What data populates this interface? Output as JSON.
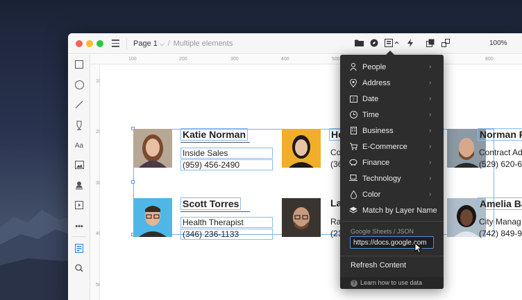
{
  "header": {
    "page_label": "Page 1",
    "breadcrumb_sub": "Multiple elements",
    "zoom": "100%"
  },
  "rulers": {
    "top": [
      "100",
      "200",
      "300",
      "400",
      "500",
      "600",
      "700",
      "800"
    ],
    "left": [
      "100",
      "200",
      "300",
      "400",
      "500"
    ]
  },
  "cards": [
    {
      "name": "Katie Norman",
      "role": "Inside Sales",
      "phone": "(959) 456-2490",
      "photo_bg": "#c9b9a8"
    },
    {
      "name": "He",
      "role": "Co",
      "phone": "(36",
      "photo_bg": "#f2b02a"
    },
    {
      "name": "Norman F",
      "role": "Contract Ad",
      "phone": "(529) 620-6",
      "photo_bg": "#8a7a6a"
    },
    {
      "name": "Scott Torres",
      "role": "Health Therapist",
      "phone": "(346) 236-1133",
      "photo_bg": "#52b7e6"
    },
    {
      "name": "La",
      "role": "Ra",
      "phone": "(21",
      "photo_bg": "#5a4a40"
    },
    {
      "name": "Amelia Ba",
      "role": "City Manag",
      "phone": "(742) 849-9",
      "photo_bg": "#a6b6c4"
    }
  ],
  "partial_texts": {
    "card2_name_tail": "r",
    "card2_role_tail": "ctor"
  },
  "dropdown": {
    "items": [
      {
        "label": "People",
        "icon": "person-icon",
        "has_submenu": true
      },
      {
        "label": "Address",
        "icon": "location-pin-icon",
        "has_submenu": true
      },
      {
        "label": "Date",
        "icon": "calendar-icon",
        "has_submenu": true
      },
      {
        "label": "Time",
        "icon": "clock-icon",
        "has_submenu": true
      },
      {
        "label": "Business",
        "icon": "building-icon",
        "has_submenu": true
      },
      {
        "label": "E-Commerce",
        "icon": "cart-icon",
        "has_submenu": true
      },
      {
        "label": "Finance",
        "icon": "piggy-bank-icon",
        "has_submenu": true
      },
      {
        "label": "Technology",
        "icon": "laptop-icon",
        "has_submenu": true
      },
      {
        "label": "Color",
        "icon": "droplet-icon",
        "has_submenu": true
      },
      {
        "label": "Match by Layer Name",
        "icon": "layers-icon",
        "has_submenu": false
      }
    ],
    "section_label": "Google Sheets / JSON",
    "url_value": "https://docs.google.com",
    "refresh_label": "Refresh Content",
    "help_label": "Learn how to use data"
  },
  "colors": {
    "accent": "#2e82e6",
    "menu_bg": "#2d2d2d",
    "selection": "#79b0ee"
  }
}
